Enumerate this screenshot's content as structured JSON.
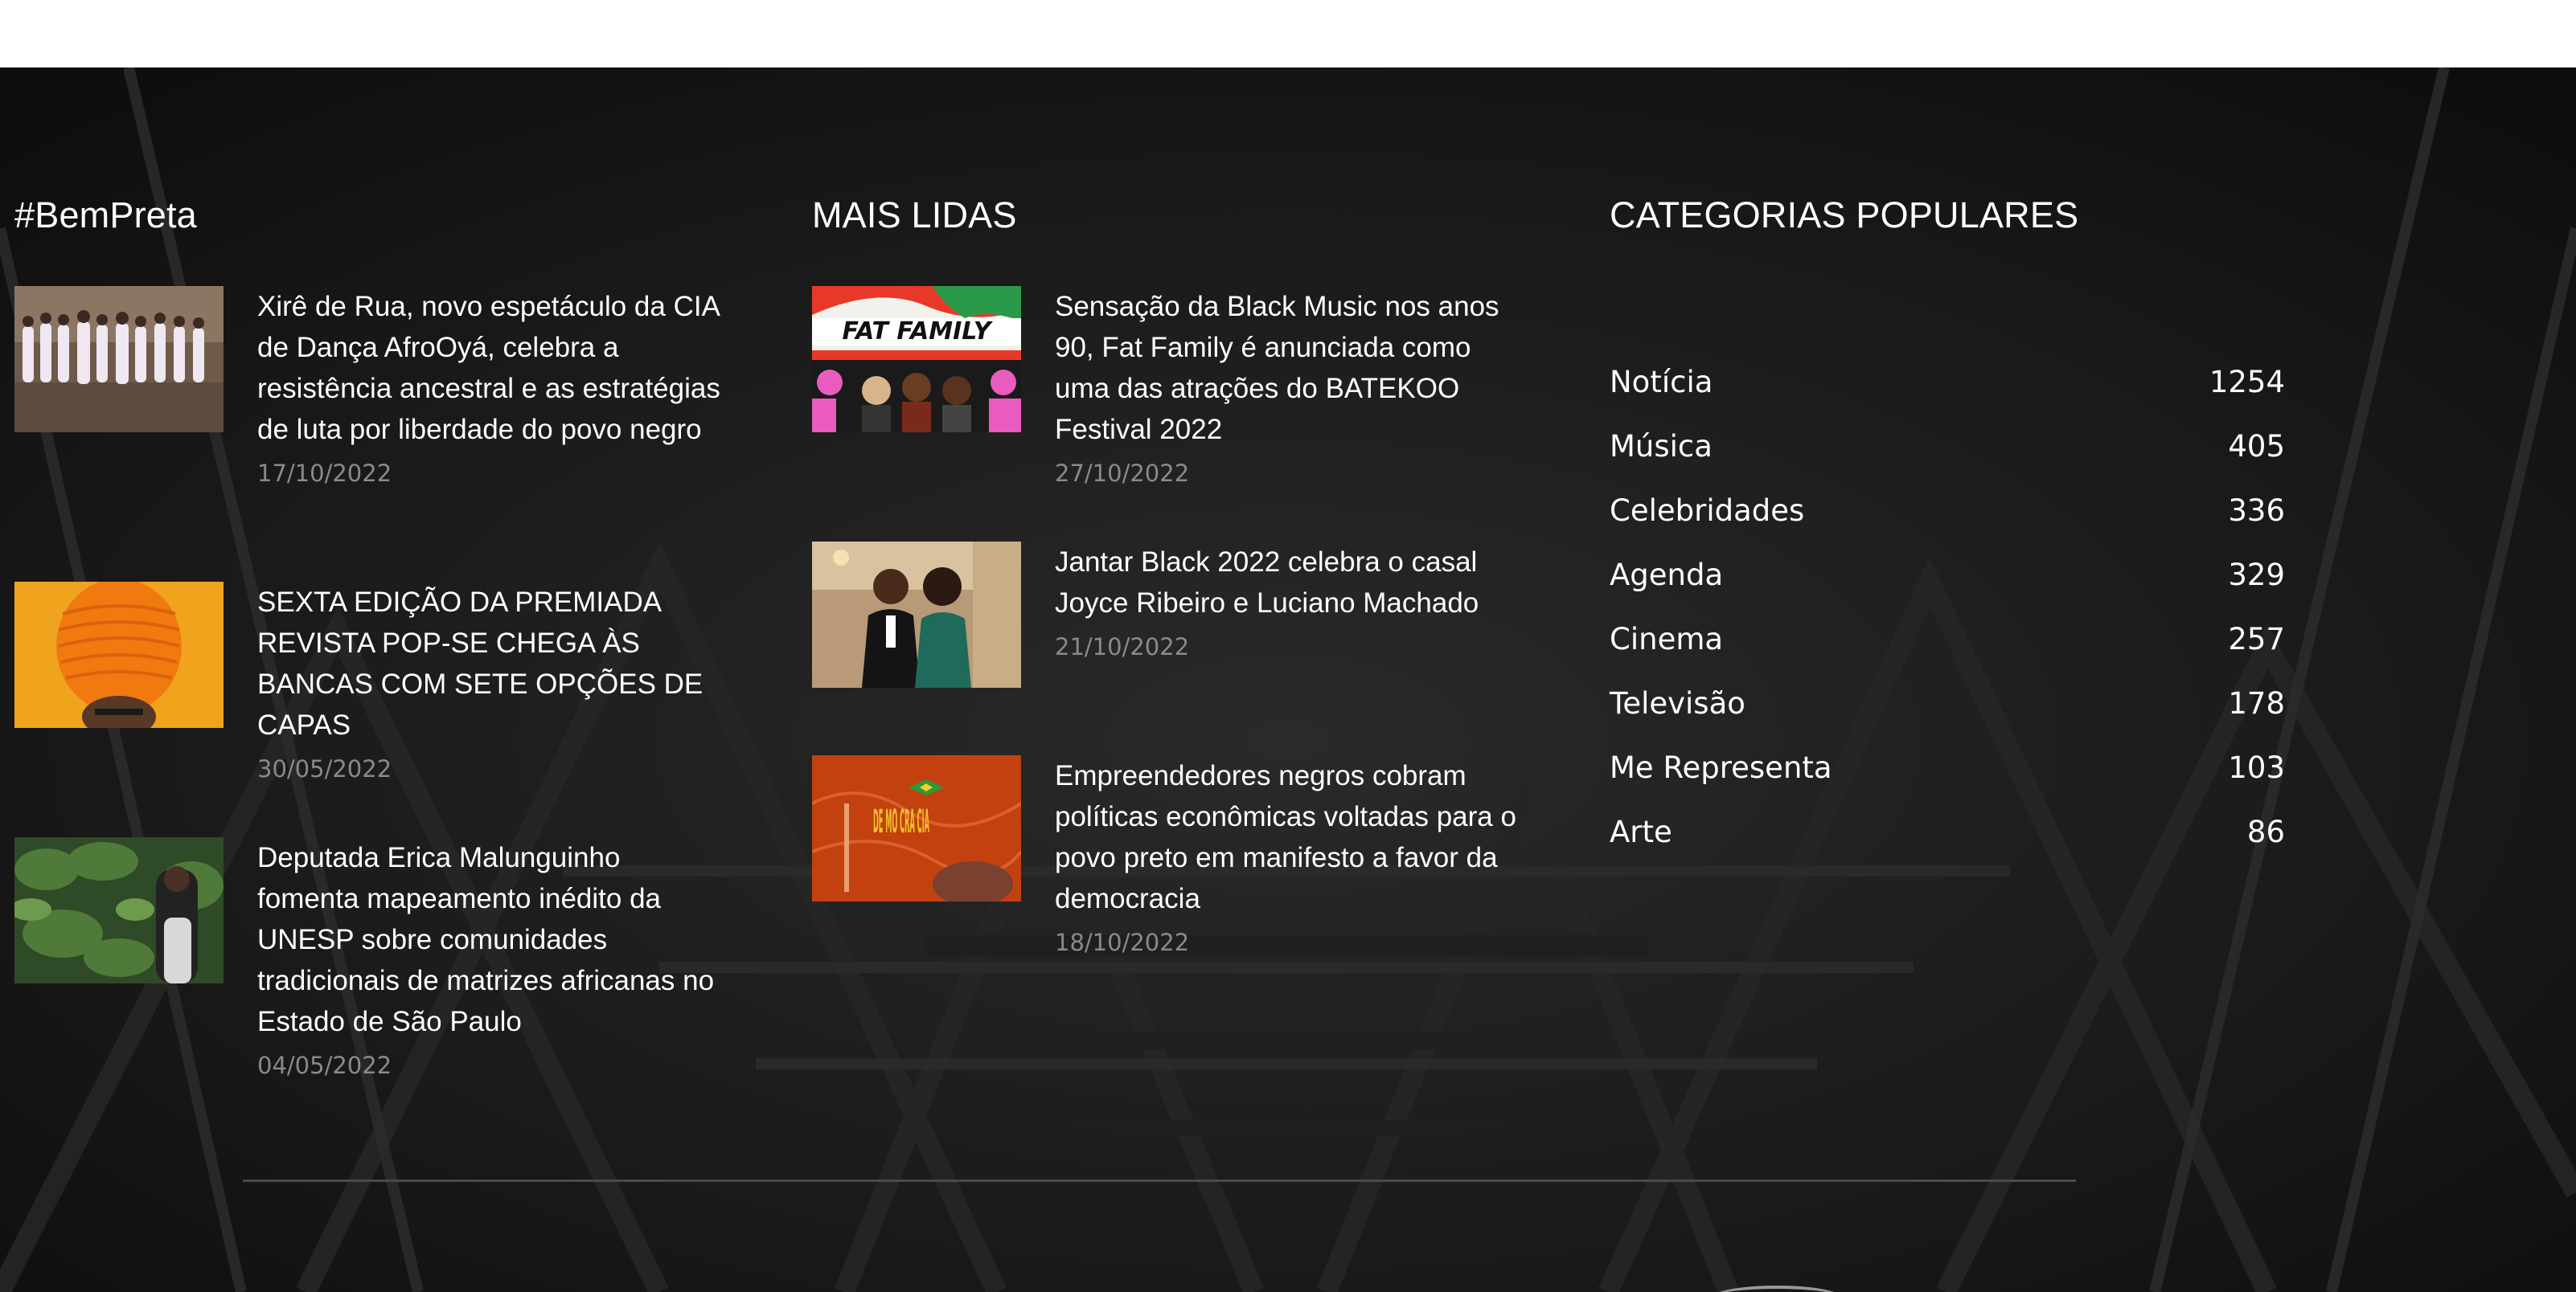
{
  "sections": {
    "bem_preta": {
      "title": "#BemPreta",
      "posts": [
        {
          "title": "Xirê de Rua, novo espetáculo da CIA de Dança AfroOyá, celebra a resistência ancestral e as estratégias de luta por liberdade do povo negro",
          "date": "17/10/2022"
        },
        {
          "title": "SEXTA EDIÇÃO DA PREMIADA REVISTA POP-SE CHEGA ÀS BANCAS COM SETE OPÇÕES DE CAPAS",
          "date": "30/05/2022"
        },
        {
          "title": "Deputada Erica Malunguinho fomenta mapeamento inédito da UNESP sobre comunidades tradicionais de matrizes africanas no Estado de São Paulo",
          "date": "04/05/2022"
        }
      ]
    },
    "mais_lidas": {
      "title": "MAIS LIDAS",
      "posts": [
        {
          "title": "Sensação da Black Music nos anos 90, Fat Family é anunciada como uma das atrações do BATEKOO Festival 2022",
          "date": "27/10/2022",
          "thumb_text": "FAT FAMILY"
        },
        {
          "title": "Jantar Black 2022 celebra o casal Joyce Ribeiro e Luciano Machado",
          "date": "21/10/2022"
        },
        {
          "title": "Empreendedores negros cobram políticas econômicas voltadas para o povo preto em manifesto a favor da democracia",
          "date": "18/10/2022",
          "thumb_text": "DE MO CRA CIA"
        }
      ]
    },
    "categorias": {
      "title": "CATEGORIAS POPULARES",
      "items": [
        {
          "name": "Notícia",
          "count": "1254"
        },
        {
          "name": "Música",
          "count": "405"
        },
        {
          "name": "Celebridades",
          "count": "336"
        },
        {
          "name": "Agenda",
          "count": "329"
        },
        {
          "name": "Cinema",
          "count": "257"
        },
        {
          "name": "Televisão",
          "count": "178"
        },
        {
          "name": "Me Representa",
          "count": "103"
        },
        {
          "name": "Arte",
          "count": "86"
        }
      ]
    }
  },
  "colors": {
    "footer_bg": "#141414",
    "text": "#ffffff",
    "date": "#8a8a8a"
  }
}
